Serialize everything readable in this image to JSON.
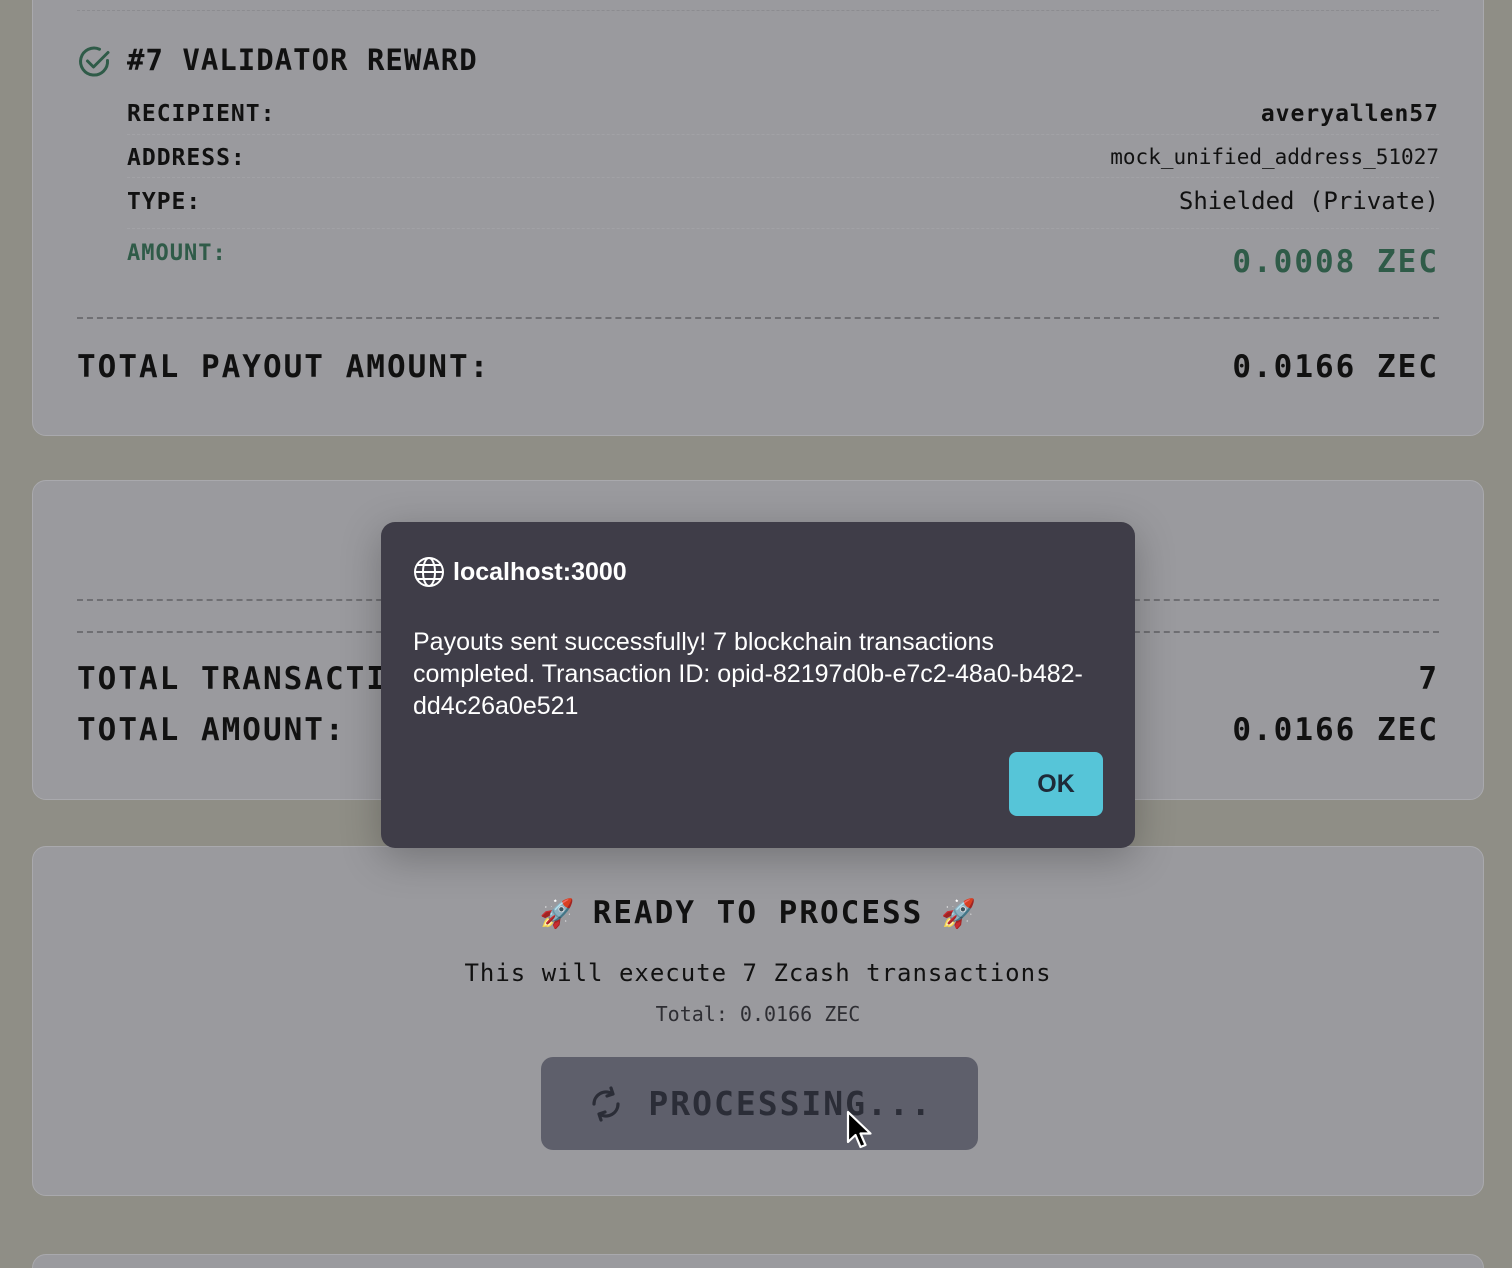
{
  "payout_card": {
    "title": "#7 VALIDATOR REWARD",
    "rows": [
      {
        "label": "RECIPIENT:",
        "value": "averyallen57"
      },
      {
        "label": "ADDRESS:",
        "value": "mock_unified_address_51027"
      },
      {
        "label": "TYPE:",
        "value": "Shielded (Private)"
      },
      {
        "label": "AMOUNT:",
        "value": "0.0008 ZEC"
      }
    ],
    "total_label": "TOTAL PAYOUT AMOUNT:",
    "total_value": "0.0166 ZEC"
  },
  "summary_card": {
    "total_transactions_label": "TOTAL TRANSACTIONS:",
    "total_transactions_value": "7",
    "total_amount_label": "TOTAL AMOUNT:",
    "total_amount_value": "0.0166 ZEC"
  },
  "process_card": {
    "emoji": "🚀",
    "title": "READY TO PROCESS",
    "description": "This will execute 7 Zcash transactions",
    "total": "Total: 0.0166 ZEC",
    "button_label": "PROCESSING..."
  },
  "dialog": {
    "origin": "localhost:3000",
    "message": "Payouts sent successfully! 7 blockchain transactions completed. Transaction ID: opid-82197d0b-e7c2-48a0-b482-dd4c26a0e521",
    "ok_label": "OK"
  },
  "icons": {
    "check": "check-circle-icon",
    "globe": "globe-icon",
    "spinner": "refresh-icon",
    "cursor": "mouse-pointer-icon"
  },
  "colors": {
    "accent_green": "#2f5b48",
    "dialog_bg": "#3f3d48",
    "ok_button": "#56c5d8"
  }
}
